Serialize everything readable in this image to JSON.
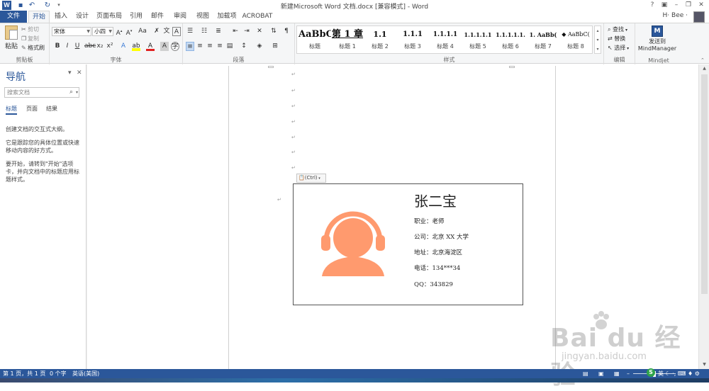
{
  "window": {
    "title": "新建Microsoft Word 文档.docx [兼容模式] - Word",
    "help": "?",
    "user": "H· Bee ·"
  },
  "tabs": [
    "文件",
    "开始",
    "插入",
    "设计",
    "页面布局",
    "引用",
    "邮件",
    "审阅",
    "视图",
    "加载项",
    "ACROBAT"
  ],
  "clipboard": {
    "paste": "粘贴",
    "cut": "剪切",
    "copy": "复制",
    "format_painter": "格式刷",
    "label": "剪贴板"
  },
  "font": {
    "name": "宋体",
    "size": "小四",
    "label": "字体"
  },
  "paragraph": {
    "label": "段落"
  },
  "styles": {
    "label": "样式",
    "items": [
      {
        "sample": "AaBbC(",
        "name": "标题"
      },
      {
        "sample": "第 1 章",
        "name": "标题 1"
      },
      {
        "sample": "1.1",
        "name": "标题 2"
      },
      {
        "sample": "1.1.1",
        "name": "标题 3"
      },
      {
        "sample": "1.1.1.1",
        "name": "标题 4"
      },
      {
        "sample": "1.1.1.1.1",
        "name": "标题 5"
      },
      {
        "sample": "1.1.1.1.1.",
        "name": "标题 6"
      },
      {
        "sample": "1.  AaBb(",
        "name": "标题 7"
      },
      {
        "sample": "◆ AaBbC(",
        "name": "标题 8"
      }
    ]
  },
  "editing": {
    "find": "查找",
    "replace": "替换",
    "select": "选择",
    "label": "编辑"
  },
  "mindjet": {
    "send": "发送到",
    "app": "MindManager",
    "label": "Mindjet"
  },
  "navigation": {
    "title": "导航",
    "search_placeholder": "搜索文档",
    "tabs": [
      "标题",
      "页面",
      "结果"
    ],
    "para1": "创建文档的交互式大纲。",
    "para2": "它是跟踪您的具体位置或快速移动内容的好方式。",
    "para3": "要开始，请转到\"开始\"选项卡，并向文档中的标题应用标题样式。"
  },
  "document": {
    "paste_options": "(Ctrl)",
    "card": {
      "name": "张二宝",
      "job": "职业：老师",
      "company": "公司：北京 XX 大学",
      "address": "地址：北京海淀区",
      "phone": "电话：134***34",
      "qq": "QQ：343829"
    },
    "accent_color": "#ff9a6e"
  },
  "status": {
    "page": "第 1 页，共 1 页",
    "words": "0 个字",
    "language": "英语(美国)"
  },
  "watermark": {
    "main": "Bai du 经验",
    "url": "jingyan.baidu.com"
  }
}
